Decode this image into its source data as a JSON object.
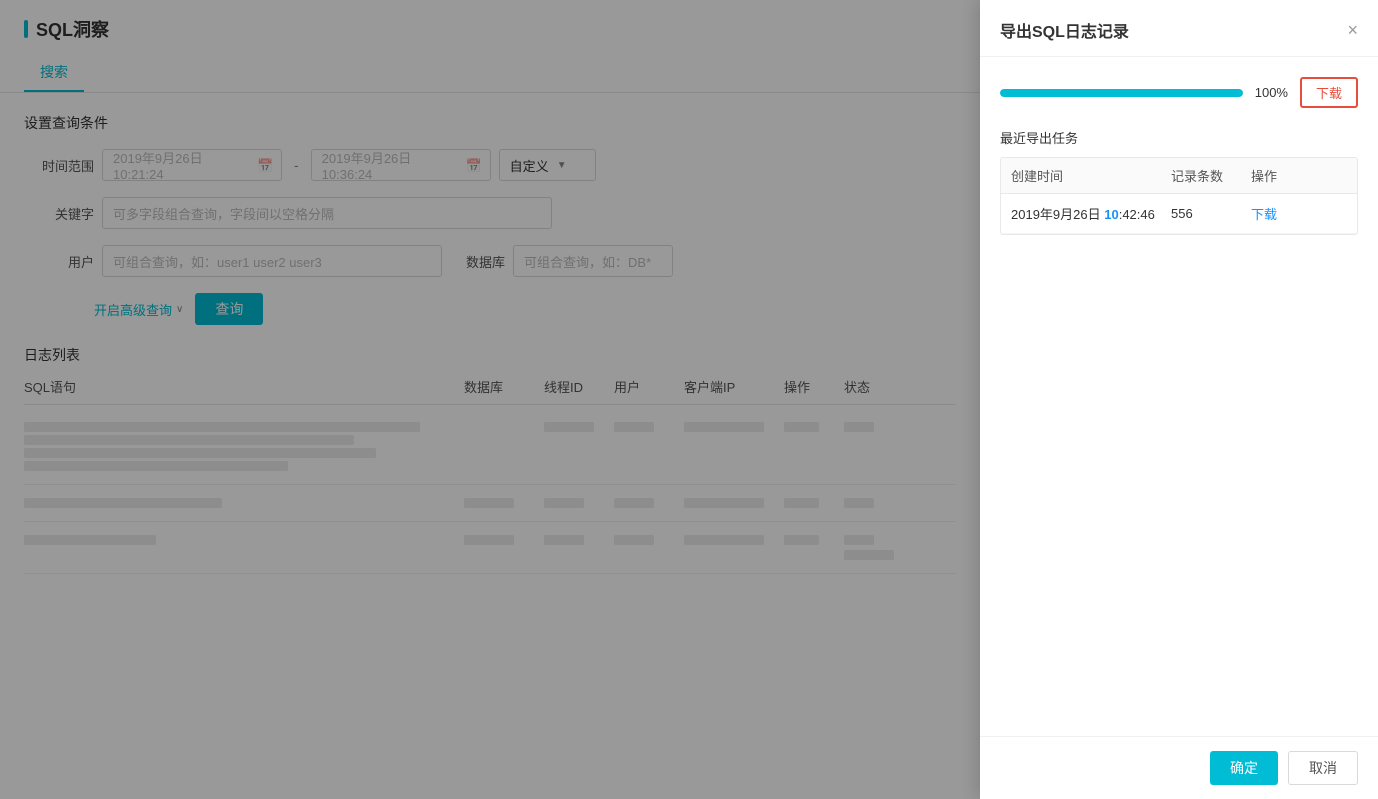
{
  "page": {
    "title": "SQL洞察",
    "tab_search": "搜索",
    "tab_underline_color": "#00bcd4"
  },
  "search": {
    "section_label": "设置查询条件",
    "time_range_label": "时间范围",
    "time_start": "2019年9月26日 10:21:24",
    "time_end": "2019年9月26日 10:36:24",
    "time_mode": "自定义",
    "keyword_label": "关键字",
    "keyword_placeholder": "可多字段组合查询，字段间以空格分隔",
    "user_label": "用户",
    "user_placeholder": "可组合查询，如：user1 user2 user3",
    "db_label": "数据库",
    "db_placeholder": "可组合查询，如：DB*",
    "advanced_link": "开启高级查询",
    "query_btn": "查询"
  },
  "log_table": {
    "section_label": "日志列表",
    "columns": [
      "SQL语句",
      "数据库",
      "线程ID",
      "用户",
      "客户端IP",
      "操作",
      "状态"
    ]
  },
  "dialog": {
    "title": "导出SQL日志记录",
    "close_icon": "×",
    "progress_pct": "100%",
    "download_btn": "下载",
    "recent_label": "最近导出任务",
    "table_headers": [
      "创建时间",
      "记录条数",
      "操作"
    ],
    "export_row": {
      "time_prefix": "2019年9月26日 10",
      "time_suffix": ":42:46",
      "time_highlight": "10",
      "count": "556",
      "action": "下载"
    },
    "confirm_btn": "确定",
    "cancel_btn": "取消"
  }
}
